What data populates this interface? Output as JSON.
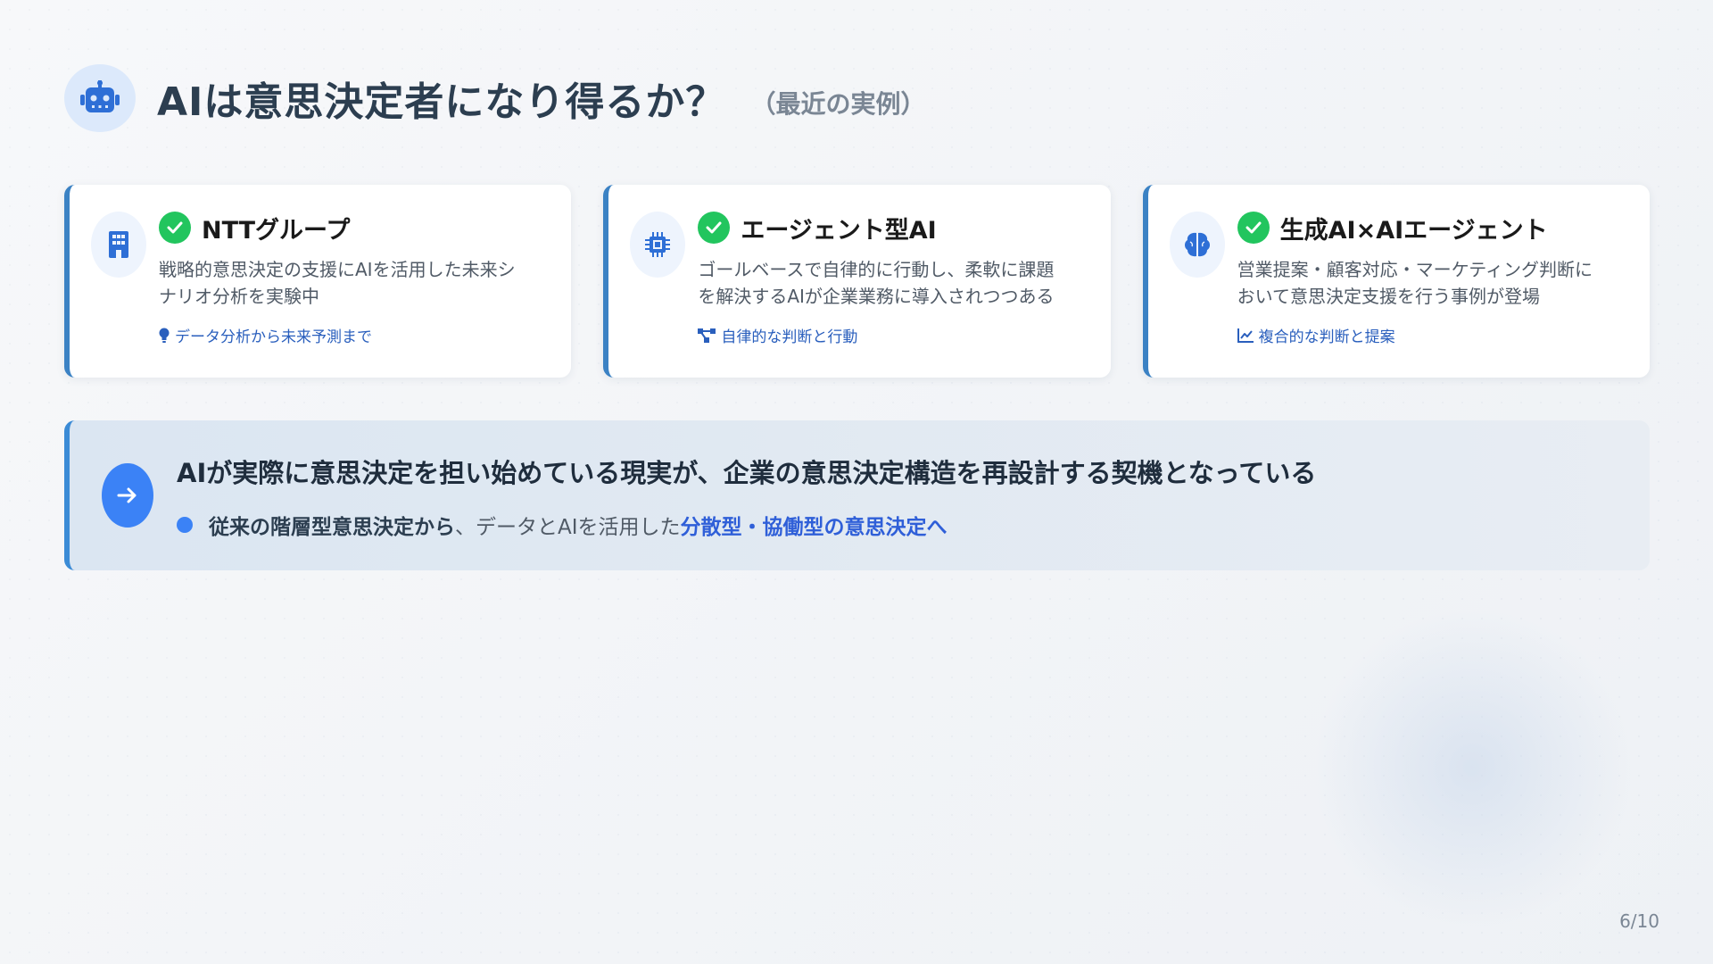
{
  "header": {
    "icon": "robot-icon",
    "title": "AIは意思決定者になり得るか？",
    "subtitle": "（最近の実例）"
  },
  "cards": [
    {
      "icon": "building-icon",
      "title": "NTTグループ",
      "desc_line1": "戦略的意思決定の支援にAIを活用した未来シ",
      "desc_line2": "ナリオ分析を実験中",
      "tag_icon": "lightbulb-icon",
      "tag": "データ分析から未来予測まで"
    },
    {
      "icon": "chip-icon",
      "title": "エージェント型AI",
      "desc_line1": "ゴールベースで自律的に行動し、柔軟に課題",
      "desc_line2": "を解決するAIが企業業務に導入されつつある",
      "tag_icon": "network-icon",
      "tag": "自律的な判断と行動"
    },
    {
      "icon": "brain-icon",
      "title": "生成AI×AIエージェント",
      "desc_line1": "営業提案・顧客対応・マーケティング判断に",
      "desc_line2": "おいて意思決定支援を行う事例が登場",
      "tag_icon": "line-chart-icon",
      "tag": "複合的な判断と提案"
    }
  ],
  "banner": {
    "icon": "arrow-right-icon",
    "main": "AIが実際に意思決定を担い始めている現実が、企業の意思決定構造を再設計する契機となっている",
    "sub_bold": "従来の階層型意思決定から",
    "sub_normal": "、データとAIを活用した",
    "sub_accent": "分散型・協働型の意思決定へ"
  },
  "page_number": "6/10",
  "colors": {
    "accent": "#3b82f6",
    "check": "#22c55e",
    "card_border": "#3b82c4",
    "tag_text": "#2a5fbd"
  }
}
